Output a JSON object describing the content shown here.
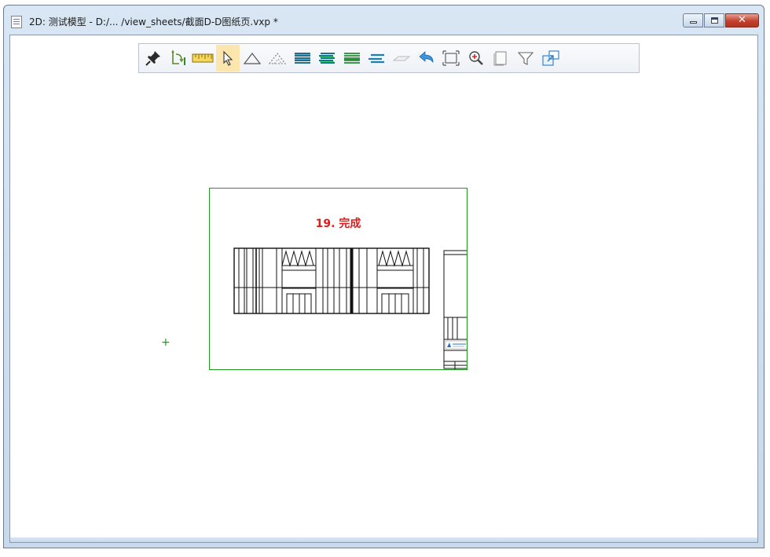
{
  "window": {
    "title": "2D: 测试模型 - D:/... /view_sheets/截面D-D图纸页.vxp *",
    "minimize_glyph": "–",
    "maximize_glyph": "□",
    "close_glyph": "✕"
  },
  "toolbar": {
    "tools": [
      {
        "name": "pin",
        "icon": "pin-icon",
        "active": false
      },
      {
        "name": "rotate-view",
        "icon": "rotate-arrow-icon",
        "active": false
      },
      {
        "name": "measure",
        "icon": "ruler-icon",
        "active": false
      },
      {
        "name": "select",
        "icon": "cursor-arrow-icon",
        "active": true
      },
      {
        "name": "area",
        "icon": "triangle-icon",
        "active": false
      },
      {
        "name": "dashed-area",
        "icon": "dashed-triangle-icon",
        "active": false
      },
      {
        "name": "layers",
        "icon": "layers-icon",
        "active": false
      },
      {
        "name": "layers-2",
        "icon": "layers-icon",
        "active": false
      },
      {
        "name": "layers-3",
        "icon": "layers-icon",
        "active": false
      },
      {
        "name": "layer-single",
        "icon": "layer-icon",
        "active": false
      },
      {
        "name": "plane",
        "icon": "plane-icon",
        "active": false
      },
      {
        "name": "undo",
        "icon": "undo-arrow-icon",
        "active": false
      },
      {
        "name": "fit-frame",
        "icon": "fit-frame-icon",
        "active": false
      },
      {
        "name": "zoom-in",
        "icon": "zoom-in-icon",
        "active": false
      },
      {
        "name": "page",
        "icon": "page-icon",
        "active": false
      },
      {
        "name": "filter",
        "icon": "filter-icon",
        "active": false
      },
      {
        "name": "export",
        "icon": "export-icon",
        "active": false
      }
    ],
    "accent_color": "#fde6ae"
  },
  "sheet": {
    "title": "19. 完成",
    "title_color": "#e11a1a",
    "border_color": "#1e9a1e"
  },
  "origin_marker": "+"
}
